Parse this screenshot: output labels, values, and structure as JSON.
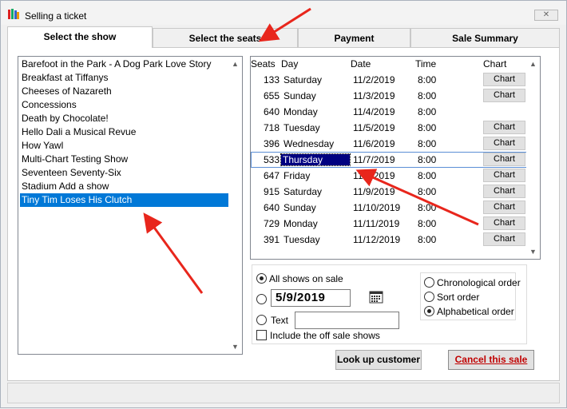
{
  "window": {
    "title": "Selling a ticket",
    "close_label": "✕"
  },
  "tabs": [
    {
      "label": "Select the show",
      "active": true
    },
    {
      "label": "Select the seats",
      "active": false
    },
    {
      "label": "Payment",
      "active": false
    },
    {
      "label": "Sale Summary",
      "active": false
    }
  ],
  "shows": [
    "Barefoot in the Park - A Dog Park Love Story",
    "Breakfast at Tiffanys",
    "Cheeses of Nazareth",
    "Concessions",
    "Death by Chocolate!",
    "Hello Dali  a Musical Revue",
    "How Yawl",
    "Multi-Chart Testing Show",
    "Seventeen Seventy-Six",
    "Stadium Add a show",
    "Tiny Tim Loses His Clutch"
  ],
  "selected_show": "Tiny Tim Loses His Clutch",
  "performances": {
    "headers": {
      "seats": "Seats",
      "day": "Day",
      "date": "Date",
      "time": "Time",
      "chart": "Chart"
    },
    "chart_button_label": "Chart",
    "rows": [
      {
        "seats": "133",
        "day": "Saturday",
        "date": "11/2/2019",
        "time": "8:00",
        "chart": true
      },
      {
        "seats": "655",
        "day": "Sunday",
        "date": "11/3/2019",
        "time": "8:00",
        "chart": true
      },
      {
        "seats": "640",
        "day": "Monday",
        "date": "11/4/2019",
        "time": "8:00",
        "chart": false
      },
      {
        "seats": "718",
        "day": "Tuesday",
        "date": "11/5/2019",
        "time": "8:00",
        "chart": true
      },
      {
        "seats": "396",
        "day": "Wednesday",
        "date": "11/6/2019",
        "time": "8:00",
        "chart": true
      },
      {
        "seats": "533",
        "day": "Thursday",
        "date": "11/7/2019",
        "time": "8:00",
        "chart": true
      },
      {
        "seats": "647",
        "day": "Friday",
        "date": "11/8/2019",
        "time": "8:00",
        "chart": true
      },
      {
        "seats": "915",
        "day": "Saturday",
        "date": "11/9/2019",
        "time": "8:00",
        "chart": true
      },
      {
        "seats": "640",
        "day": "Sunday",
        "date": "11/10/2019",
        "time": "8:00",
        "chart": true
      },
      {
        "seats": "729",
        "day": "Monday",
        "date": "11/11/2019",
        "time": "8:00",
        "chart": true
      },
      {
        "seats": "391",
        "day": "Tuesday",
        "date": "11/12/2019",
        "time": "8:00",
        "chart": true
      }
    ],
    "selected_row": 5
  },
  "filters": {
    "all_shows_label": "All shows on sale",
    "date_value": "5/9/2019",
    "text_label": "Text",
    "text_value": "",
    "include_off_sale_label": "Include the off sale shows",
    "selected": "all_shows"
  },
  "sort": {
    "chronological_label": "Chronological order",
    "sort_label": "Sort order",
    "alphabetical_label": "Alphabetical order",
    "selected": "alphabetical"
  },
  "buttons": {
    "lookup_label": "Look up customer",
    "cancel_label": "Cancel this sale"
  },
  "colors": {
    "selection": "#0078d7",
    "annotation_arrows": "#e8261c",
    "cancel_text": "#c00000"
  }
}
